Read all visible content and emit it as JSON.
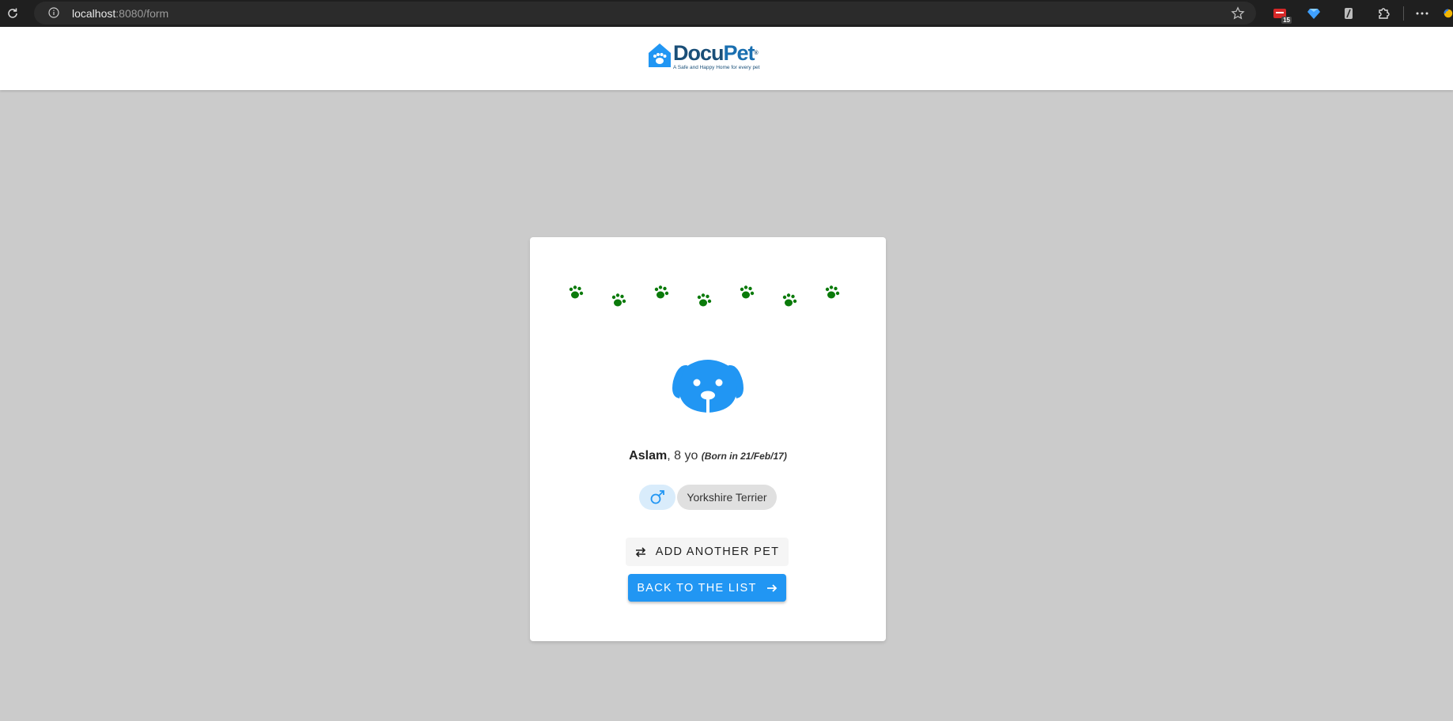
{
  "browser": {
    "url_host": "localhost",
    "url_path": ":8080/form",
    "extension_badge": "15"
  },
  "header": {
    "logo_name_part1": "Docu",
    "logo_name_part2": "Pet",
    "logo_reg": "®",
    "logo_tagline": "A Safe and Happy Home for every pet"
  },
  "pet": {
    "name": "Aslam",
    "age_text": ", 8 yo",
    "born_text": "(Born in 21/Feb/17)",
    "gender_icon": "male-icon",
    "breed": "Yorkshire Terrier"
  },
  "actions": {
    "add_label": "ADD ANOTHER PET",
    "back_label": "BACK TO THE LIST"
  },
  "colors": {
    "paw": "#0a7a0a",
    "primary": "#2196f3",
    "header_bg": "#ffffff",
    "page_bg": "#cbcbcb"
  },
  "icons": {
    "paws": "paw-icon",
    "avatar": "dog-icon",
    "add": "swap-icon",
    "back": "arrow-right-icon"
  }
}
